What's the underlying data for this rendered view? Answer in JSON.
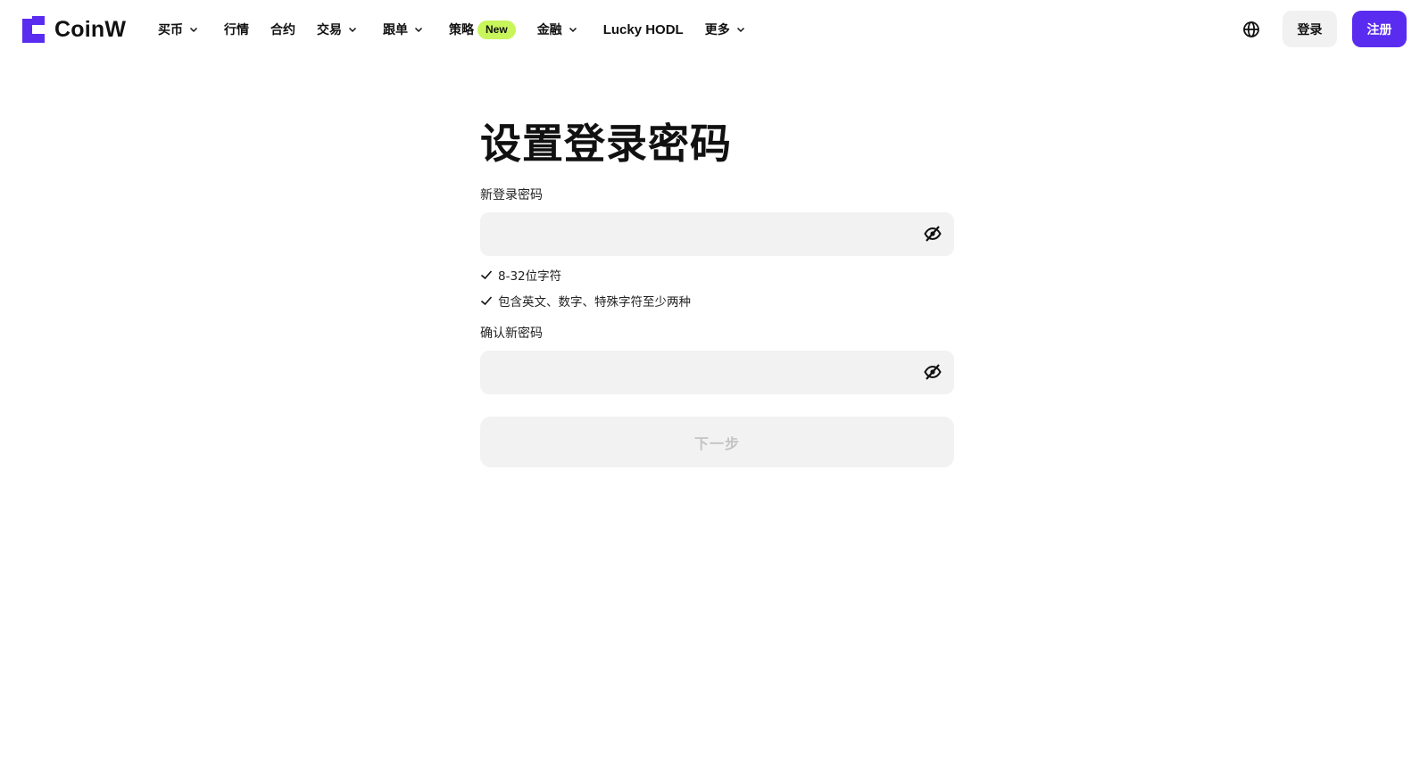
{
  "header": {
    "brand": "CoinW",
    "brand_color": "#5a2cf0",
    "nav": [
      {
        "label": "买币",
        "dropdown": true
      },
      {
        "label": "行情",
        "dropdown": false
      },
      {
        "label": "合约",
        "dropdown": false
      },
      {
        "label": "交易",
        "dropdown": true
      },
      {
        "label": "跟单",
        "dropdown": true
      },
      {
        "label": "策略",
        "dropdown": false,
        "badge": "New"
      },
      {
        "label": "金融",
        "dropdown": true
      },
      {
        "label": "Lucky HODL",
        "dropdown": false
      },
      {
        "label": "更多",
        "dropdown": true
      }
    ],
    "language_icon": "globe-icon",
    "login_label": "登录",
    "register_label": "注册"
  },
  "form": {
    "title": "设置登录密码",
    "new_password": {
      "label": "新登录密码",
      "value": "",
      "toggle_icon": "eye-off-icon"
    },
    "rules": [
      {
        "text": "8-32位字符",
        "icon": "check-icon"
      },
      {
        "text": "包含英文、数字、特殊字符至少两种",
        "icon": "check-icon"
      }
    ],
    "confirm_password": {
      "label": "确认新密码",
      "value": "",
      "toggle_icon": "eye-off-icon"
    },
    "next_label": "下一步"
  },
  "colors": {
    "accent": "#5a2cf0",
    "badge_bg": "#c8f55a",
    "input_bg": "#f2f2f2",
    "disabled_text": "#c4c4c4"
  }
}
